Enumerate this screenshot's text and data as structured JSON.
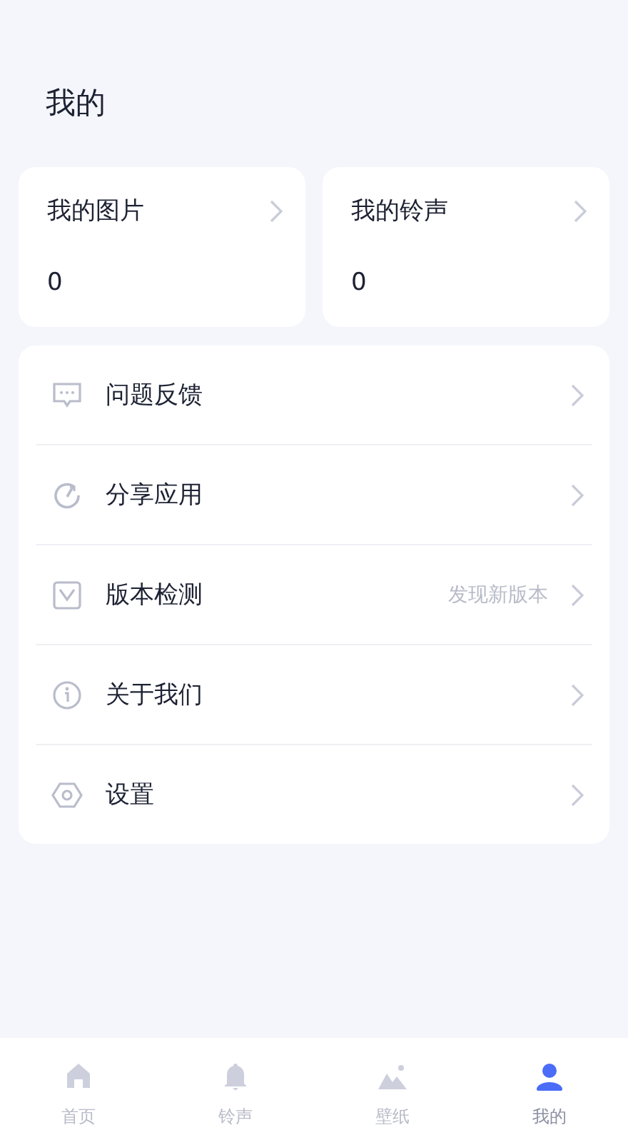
{
  "page_title": "我的",
  "stat_cards": [
    {
      "label": "我的图片",
      "value": "0"
    },
    {
      "label": "我的铃声",
      "value": "0"
    }
  ],
  "menu": [
    {
      "label": "问题反馈"
    },
    {
      "label": "分享应用"
    },
    {
      "label": "版本检测",
      "hint": "发现新版本"
    },
    {
      "label": "关于我们"
    },
    {
      "label": "设置"
    }
  ],
  "tab_bar": [
    {
      "label": "首页",
      "selected": false
    },
    {
      "label": "铃声",
      "selected": false
    },
    {
      "label": "壁纸",
      "selected": false
    },
    {
      "label": "我的",
      "selected": true
    }
  ]
}
